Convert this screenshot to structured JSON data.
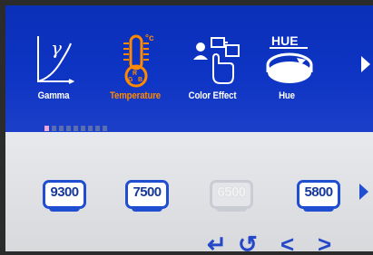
{
  "menu": {
    "items": [
      {
        "label": "Gamma",
        "icon": "gamma-curve-icon",
        "symbol": "γ"
      },
      {
        "label": "Temperature",
        "icon": "thermometer-icon",
        "symbol": "°c",
        "active": true
      },
      {
        "label": "Color Effect",
        "icon": "color-effect-icon"
      },
      {
        "label": "Hue",
        "icon": "hue-icon",
        "symbol": "HUE"
      }
    ]
  },
  "presets": {
    "items": [
      {
        "label": "9300",
        "enabled": true
      },
      {
        "label": "7500",
        "enabled": true
      },
      {
        "label": "6500",
        "enabled": false
      },
      {
        "label": "5800",
        "enabled": true
      }
    ]
  },
  "nav_glyphs": [
    "↵",
    "↺",
    "<",
    ">"
  ],
  "colors": {
    "panel_blue": "#0e34c4",
    "active_label": "#ff8a00",
    "preset_border": "#1f4fd0",
    "page_dot_active": "#f2a6d6"
  }
}
